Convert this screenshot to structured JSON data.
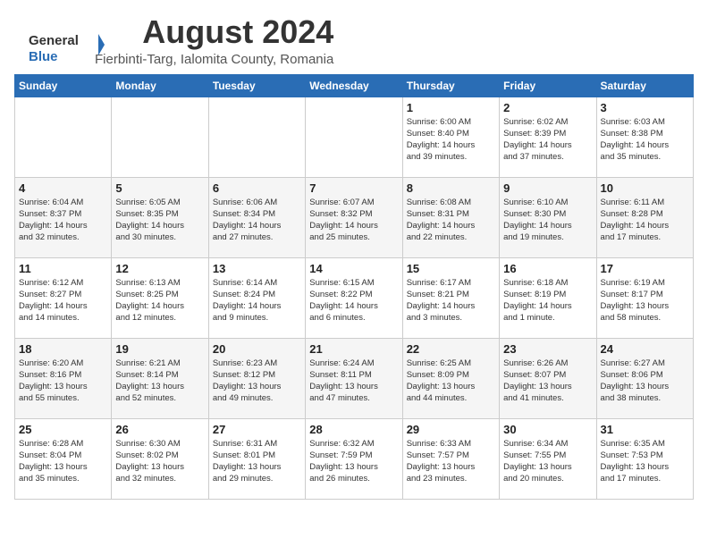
{
  "header": {
    "logo_general": "General",
    "logo_blue": "Blue",
    "title": "August 2024",
    "subtitle": "Fierbinti-Targ, Ialomita County, Romania"
  },
  "weekdays": [
    "Sunday",
    "Monday",
    "Tuesday",
    "Wednesday",
    "Thursday",
    "Friday",
    "Saturday"
  ],
  "weeks": [
    [
      {
        "day": "",
        "info": ""
      },
      {
        "day": "",
        "info": ""
      },
      {
        "day": "",
        "info": ""
      },
      {
        "day": "",
        "info": ""
      },
      {
        "day": "1",
        "info": "Sunrise: 6:00 AM\nSunset: 8:40 PM\nDaylight: 14 hours\nand 39 minutes."
      },
      {
        "day": "2",
        "info": "Sunrise: 6:02 AM\nSunset: 8:39 PM\nDaylight: 14 hours\nand 37 minutes."
      },
      {
        "day": "3",
        "info": "Sunrise: 6:03 AM\nSunset: 8:38 PM\nDaylight: 14 hours\nand 35 minutes."
      }
    ],
    [
      {
        "day": "4",
        "info": "Sunrise: 6:04 AM\nSunset: 8:37 PM\nDaylight: 14 hours\nand 32 minutes."
      },
      {
        "day": "5",
        "info": "Sunrise: 6:05 AM\nSunset: 8:35 PM\nDaylight: 14 hours\nand 30 minutes."
      },
      {
        "day": "6",
        "info": "Sunrise: 6:06 AM\nSunset: 8:34 PM\nDaylight: 14 hours\nand 27 minutes."
      },
      {
        "day": "7",
        "info": "Sunrise: 6:07 AM\nSunset: 8:32 PM\nDaylight: 14 hours\nand 25 minutes."
      },
      {
        "day": "8",
        "info": "Sunrise: 6:08 AM\nSunset: 8:31 PM\nDaylight: 14 hours\nand 22 minutes."
      },
      {
        "day": "9",
        "info": "Sunrise: 6:10 AM\nSunset: 8:30 PM\nDaylight: 14 hours\nand 19 minutes."
      },
      {
        "day": "10",
        "info": "Sunrise: 6:11 AM\nSunset: 8:28 PM\nDaylight: 14 hours\nand 17 minutes."
      }
    ],
    [
      {
        "day": "11",
        "info": "Sunrise: 6:12 AM\nSunset: 8:27 PM\nDaylight: 14 hours\nand 14 minutes."
      },
      {
        "day": "12",
        "info": "Sunrise: 6:13 AM\nSunset: 8:25 PM\nDaylight: 14 hours\nand 12 minutes."
      },
      {
        "day": "13",
        "info": "Sunrise: 6:14 AM\nSunset: 8:24 PM\nDaylight: 14 hours\nand 9 minutes."
      },
      {
        "day": "14",
        "info": "Sunrise: 6:15 AM\nSunset: 8:22 PM\nDaylight: 14 hours\nand 6 minutes."
      },
      {
        "day": "15",
        "info": "Sunrise: 6:17 AM\nSunset: 8:21 PM\nDaylight: 14 hours\nand 3 minutes."
      },
      {
        "day": "16",
        "info": "Sunrise: 6:18 AM\nSunset: 8:19 PM\nDaylight: 14 hours\nand 1 minute."
      },
      {
        "day": "17",
        "info": "Sunrise: 6:19 AM\nSunset: 8:17 PM\nDaylight: 13 hours\nand 58 minutes."
      }
    ],
    [
      {
        "day": "18",
        "info": "Sunrise: 6:20 AM\nSunset: 8:16 PM\nDaylight: 13 hours\nand 55 minutes."
      },
      {
        "day": "19",
        "info": "Sunrise: 6:21 AM\nSunset: 8:14 PM\nDaylight: 13 hours\nand 52 minutes."
      },
      {
        "day": "20",
        "info": "Sunrise: 6:23 AM\nSunset: 8:12 PM\nDaylight: 13 hours\nand 49 minutes."
      },
      {
        "day": "21",
        "info": "Sunrise: 6:24 AM\nSunset: 8:11 PM\nDaylight: 13 hours\nand 47 minutes."
      },
      {
        "day": "22",
        "info": "Sunrise: 6:25 AM\nSunset: 8:09 PM\nDaylight: 13 hours\nand 44 minutes."
      },
      {
        "day": "23",
        "info": "Sunrise: 6:26 AM\nSunset: 8:07 PM\nDaylight: 13 hours\nand 41 minutes."
      },
      {
        "day": "24",
        "info": "Sunrise: 6:27 AM\nSunset: 8:06 PM\nDaylight: 13 hours\nand 38 minutes."
      }
    ],
    [
      {
        "day": "25",
        "info": "Sunrise: 6:28 AM\nSunset: 8:04 PM\nDaylight: 13 hours\nand 35 minutes."
      },
      {
        "day": "26",
        "info": "Sunrise: 6:30 AM\nSunset: 8:02 PM\nDaylight: 13 hours\nand 32 minutes."
      },
      {
        "day": "27",
        "info": "Sunrise: 6:31 AM\nSunset: 8:01 PM\nDaylight: 13 hours\nand 29 minutes."
      },
      {
        "day": "28",
        "info": "Sunrise: 6:32 AM\nSunset: 7:59 PM\nDaylight: 13 hours\nand 26 minutes."
      },
      {
        "day": "29",
        "info": "Sunrise: 6:33 AM\nSunset: 7:57 PM\nDaylight: 13 hours\nand 23 minutes."
      },
      {
        "day": "30",
        "info": "Sunrise: 6:34 AM\nSunset: 7:55 PM\nDaylight: 13 hours\nand 20 minutes."
      },
      {
        "day": "31",
        "info": "Sunrise: 6:35 AM\nSunset: 7:53 PM\nDaylight: 13 hours\nand 17 minutes."
      }
    ]
  ]
}
